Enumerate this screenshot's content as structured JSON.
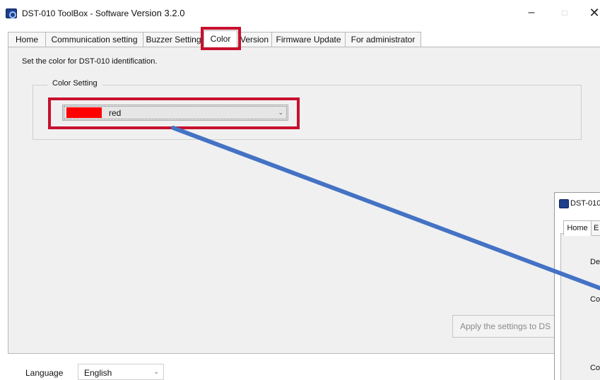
{
  "window": {
    "title": "DST-010 ToolBox - Software ",
    "version": "Version 3.2.0",
    "minimize_glyph": "–",
    "maximize_glyph": "□",
    "close_glyph": "✕"
  },
  "tabs": [
    {
      "label": "Home",
      "active": false
    },
    {
      "label": "Communication setting",
      "active": false
    },
    {
      "label": "Buzzer Setting",
      "active": false
    },
    {
      "label": "Color",
      "active": true
    },
    {
      "label": "Version",
      "active": false
    },
    {
      "label": "Firmware Update",
      "active": false
    },
    {
      "label": "For administrator",
      "active": false
    }
  ],
  "color_page": {
    "hint": "Set the color for DST-010 identification.",
    "group_title": "Color Setting",
    "selected_color": "red",
    "swatch_color": "#ff0000",
    "dropdown_chevron": "⌄",
    "apply_button": "Apply the settings to DS"
  },
  "footer": {
    "language_label": "Language",
    "language_value": "English",
    "language_chevron": "⌄"
  },
  "secondary_window": {
    "title": "DST-010",
    "tab_home": "Home",
    "tab_next": "E",
    "label_1": "De",
    "label_2": "Co",
    "label_3": "Co"
  },
  "colors": {
    "highlight": "#c8102e",
    "arrow": "#4472c4",
    "panel_bg": "#f0f0f0"
  },
  "icons": [
    "app-icon",
    "chevron-down-icon"
  ]
}
